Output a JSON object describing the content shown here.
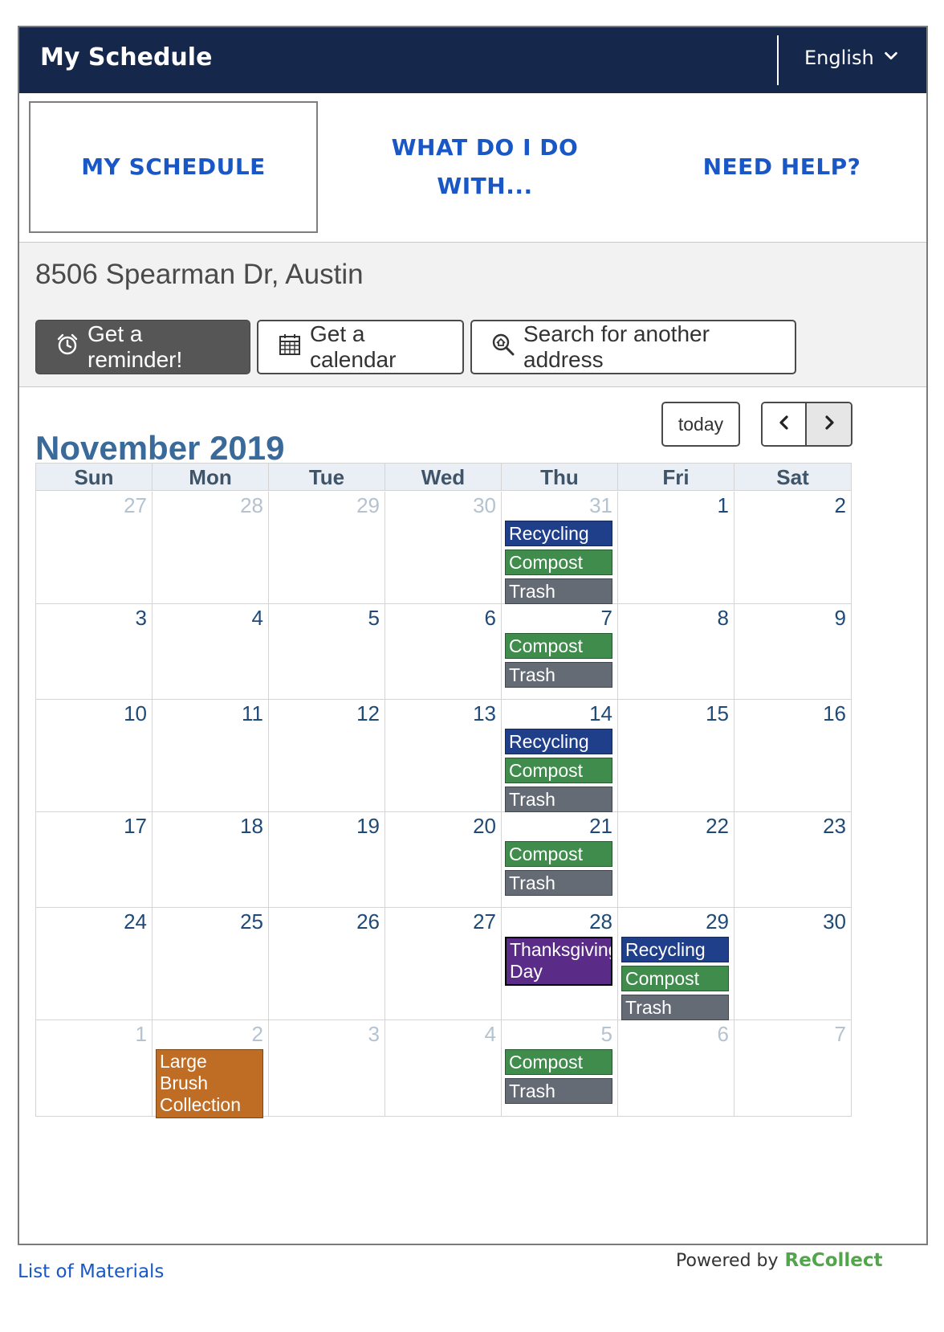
{
  "header": {
    "title": "My Schedule",
    "language": "English"
  },
  "tabs": [
    {
      "label": "MY SCHEDULE",
      "active": true
    },
    {
      "label": "WHAT DO I DO WITH...",
      "active": false
    },
    {
      "label": "NEED HELP?",
      "active": false
    }
  ],
  "address": "8506 Spearman Dr, Austin",
  "actions": {
    "reminder": "Get a reminder!",
    "calendar": "Get a calendar",
    "search": "Search for another address"
  },
  "calendar": {
    "title": "November 2019",
    "today_label": "today",
    "days_of_week": [
      "Sun",
      "Mon",
      "Tue",
      "Wed",
      "Thu",
      "Fri",
      "Sat"
    ],
    "weeks": [
      [
        {
          "day": "27",
          "other": true,
          "events": []
        },
        {
          "day": "28",
          "other": true,
          "events": []
        },
        {
          "day": "29",
          "other": true,
          "events": []
        },
        {
          "day": "30",
          "other": true,
          "events": []
        },
        {
          "day": "31",
          "other": true,
          "events": [
            {
              "label": "Recycling",
              "type": "recycling"
            },
            {
              "label": "Compost",
              "type": "compost"
            },
            {
              "label": "Trash",
              "type": "trash"
            }
          ]
        },
        {
          "day": "1",
          "other": false,
          "events": []
        },
        {
          "day": "2",
          "other": false,
          "events": []
        }
      ],
      [
        {
          "day": "3",
          "other": false,
          "events": []
        },
        {
          "day": "4",
          "other": false,
          "events": []
        },
        {
          "day": "5",
          "other": false,
          "events": []
        },
        {
          "day": "6",
          "other": false,
          "events": []
        },
        {
          "day": "7",
          "other": false,
          "events": [
            {
              "label": "Compost",
              "type": "compost"
            },
            {
              "label": "Trash",
              "type": "trash"
            }
          ]
        },
        {
          "day": "8",
          "other": false,
          "events": []
        },
        {
          "day": "9",
          "other": false,
          "events": []
        }
      ],
      [
        {
          "day": "10",
          "other": false,
          "events": []
        },
        {
          "day": "11",
          "other": false,
          "events": []
        },
        {
          "day": "12",
          "other": false,
          "events": []
        },
        {
          "day": "13",
          "other": false,
          "events": []
        },
        {
          "day": "14",
          "other": false,
          "events": [
            {
              "label": "Recycling",
              "type": "recycling"
            },
            {
              "label": "Compost",
              "type": "compost"
            },
            {
              "label": "Trash",
              "type": "trash"
            }
          ]
        },
        {
          "day": "15",
          "other": false,
          "events": []
        },
        {
          "day": "16",
          "other": false,
          "events": []
        }
      ],
      [
        {
          "day": "17",
          "other": false,
          "events": []
        },
        {
          "day": "18",
          "other": false,
          "events": []
        },
        {
          "day": "19",
          "other": false,
          "events": []
        },
        {
          "day": "20",
          "other": false,
          "events": []
        },
        {
          "day": "21",
          "other": false,
          "events": [
            {
              "label": "Compost",
              "type": "compost"
            },
            {
              "label": "Trash",
              "type": "trash"
            }
          ]
        },
        {
          "day": "22",
          "other": false,
          "events": []
        },
        {
          "day": "23",
          "other": false,
          "events": []
        }
      ],
      [
        {
          "day": "24",
          "other": false,
          "events": []
        },
        {
          "day": "25",
          "other": false,
          "events": []
        },
        {
          "day": "26",
          "other": false,
          "events": []
        },
        {
          "day": "27",
          "other": false,
          "events": []
        },
        {
          "day": "28",
          "other": false,
          "events": [
            {
              "label": "Thanksgiving Day",
              "type": "holiday"
            }
          ]
        },
        {
          "day": "29",
          "other": false,
          "events": [
            {
              "label": "Recycling",
              "type": "recycling"
            },
            {
              "label": "Compost",
              "type": "compost"
            },
            {
              "label": "Trash",
              "type": "trash"
            }
          ]
        },
        {
          "day": "30",
          "other": false,
          "events": []
        }
      ],
      [
        {
          "day": "1",
          "other": true,
          "events": []
        },
        {
          "day": "2",
          "other": true,
          "events": [
            {
              "label": "Large Brush Collection",
              "type": "brush"
            }
          ]
        },
        {
          "day": "3",
          "other": true,
          "events": []
        },
        {
          "day": "4",
          "other": true,
          "events": []
        },
        {
          "day": "5",
          "other": true,
          "events": [
            {
              "label": "Compost",
              "type": "compost"
            },
            {
              "label": "Trash",
              "type": "trash"
            }
          ]
        },
        {
          "day": "6",
          "other": true,
          "events": []
        },
        {
          "day": "7",
          "other": true,
          "events": []
        }
      ]
    ]
  },
  "footer": {
    "materials_link": "List of Materials",
    "powered_by": "Powered by",
    "brand": "ReCollect"
  },
  "colors": {
    "header_bg": "#15284b",
    "link_blue": "#1a57c6",
    "recycling": "#203f8a",
    "compost": "#3f8c4c",
    "trash": "#646b75",
    "holiday": "#5b2b88",
    "brush": "#bf6c24",
    "brand_green": "#53a54b"
  },
  "icons": {
    "reminder": "alarm-clock-icon",
    "calendar": "calendar-grid-icon",
    "search": "search-home-icon",
    "language": "chevron-down-icon",
    "prev": "chevron-left-icon",
    "next": "chevron-right-icon"
  }
}
